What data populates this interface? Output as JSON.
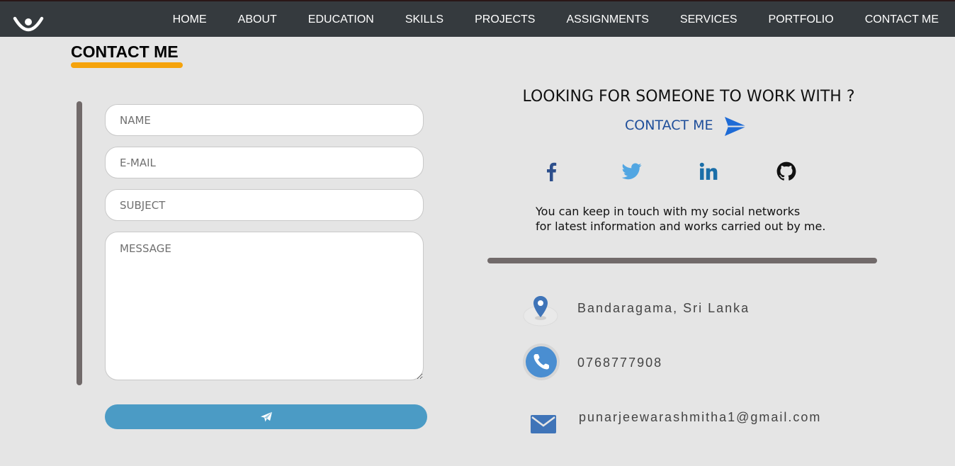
{
  "nav": {
    "logo_icon": "smile-logo-icon",
    "items": [
      {
        "label": "HOME"
      },
      {
        "label": "ABOUT"
      },
      {
        "label": "EDUCATION"
      },
      {
        "label": "SKILLS"
      },
      {
        "label": "PROJECTS"
      },
      {
        "label": "ASSIGNMENTS"
      },
      {
        "label": "SERVICES"
      },
      {
        "label": "PORTFOLIO"
      },
      {
        "label": "CONTACT ME"
      }
    ]
  },
  "section": {
    "title": "CONTACT ME",
    "accent_color": "#f5a30c"
  },
  "form": {
    "name_placeholder": "NAME",
    "email_placeholder": "E-MAIL",
    "subject_placeholder": "SUBJECT",
    "message_placeholder": "MESSAGE",
    "name_value": "",
    "email_value": "",
    "subject_value": "",
    "message_value": "",
    "submit_icon": "paper-plane-icon",
    "submit_color": "#4b9bc5"
  },
  "cta": {
    "heading": "LOOKING FOR SOMEONE TO WORK WITH ?",
    "link_label": "CONTACT ME",
    "link_color": "#1e4e9a",
    "send_icon": "send-arrow-icon"
  },
  "social": {
    "items": [
      {
        "icon": "facebook-icon",
        "color": "#2d4f8c"
      },
      {
        "icon": "twitter-icon",
        "color": "#52a6e2"
      },
      {
        "icon": "linkedin-icon",
        "color": "#1a6ea8"
      },
      {
        "icon": "github-icon",
        "color": "#111111"
      }
    ],
    "line1": "You can keep in touch with my social networks",
    "line2": "for latest information and works carried out by me."
  },
  "info": {
    "location": "Bandaragama, Sri Lanka",
    "phone": "0768777908",
    "email": "punarjeewarashmitha1@gmail.com"
  }
}
